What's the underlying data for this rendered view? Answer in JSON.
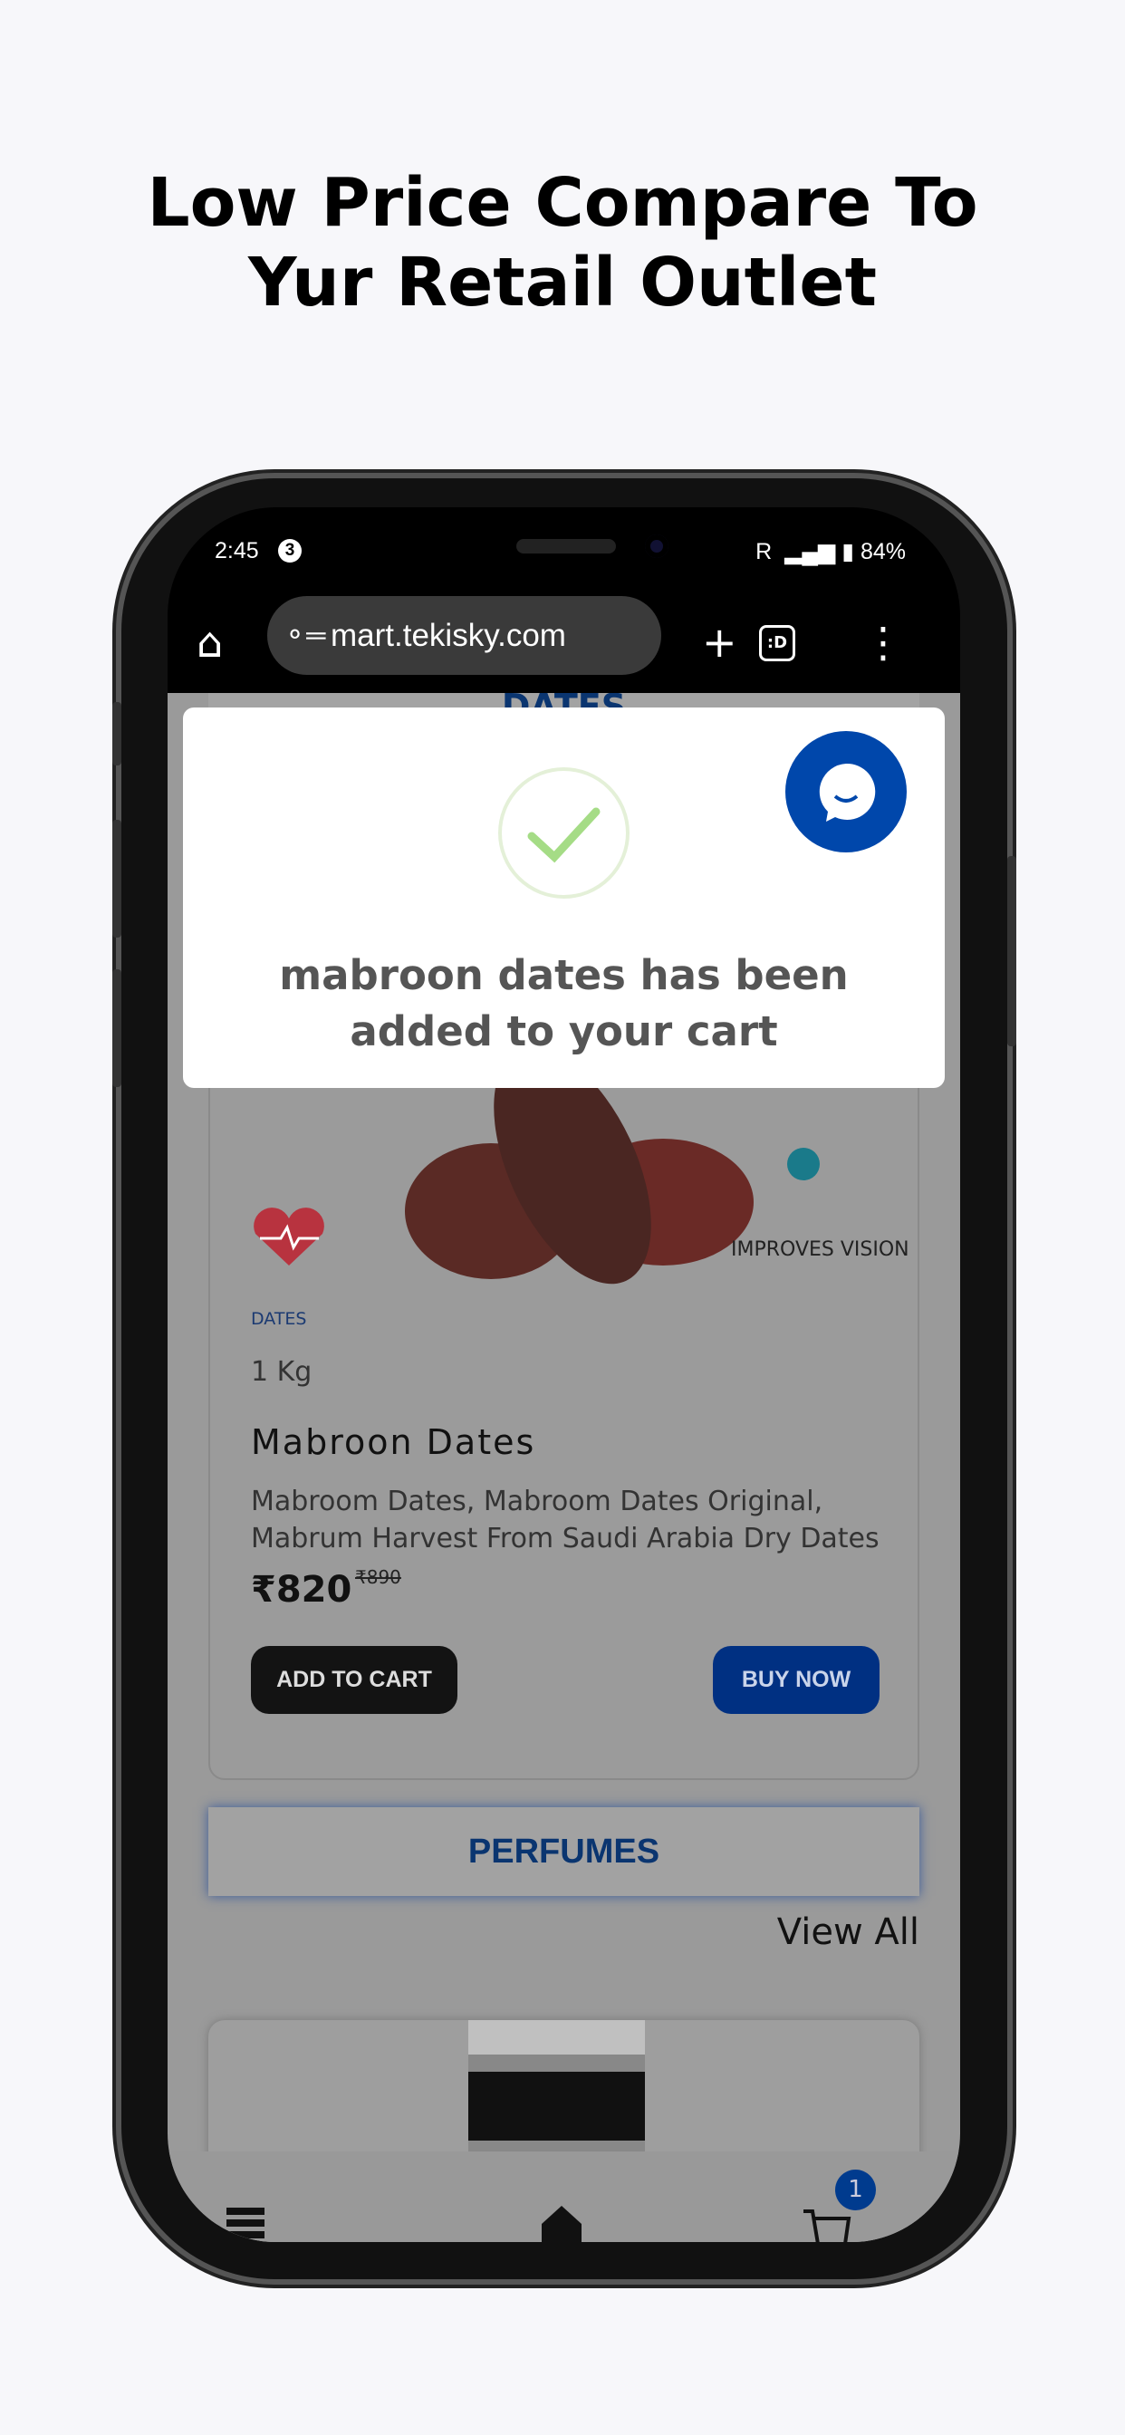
{
  "headline": {
    "line1": "Low Price Compare To",
    "line2": "Yur Retail Outlet"
  },
  "status_bar": {
    "time": "2:45",
    "notification_count": "3",
    "network": "R",
    "battery": "84%"
  },
  "browser": {
    "url": "mart.tekisky.com",
    "icons": [
      "home-icon",
      "site-settings-icon",
      "new-tab-plus-icon",
      "tab-switcher-icon",
      "more-menu-icon"
    ],
    "tab_label": ":D"
  },
  "page": {
    "top_section_title": "DATES",
    "product": {
      "category": "DATES",
      "quantity": "1 Kg",
      "name": "Mabroon Dates",
      "description": "Mabroom Dates, Mabroom Dates Original, Mabrum Harvest From Saudi Arabia Dry Dates",
      "price": "₹820",
      "mrp": "₹890",
      "image_caption": "IMPROVES VISION",
      "add_to_cart": "ADD TO CART",
      "buy_now": "BUY NOW"
    },
    "section_title": "PERFUMES",
    "view_all": "View All",
    "cart_count": "1"
  },
  "modal": {
    "message": "mabroon dates has been added to your cart",
    "icon": "check-icon"
  },
  "colors": {
    "brand_blue": "#0047ab",
    "success_green": "#a5dc86",
    "overlay": "#9a9a9a"
  }
}
